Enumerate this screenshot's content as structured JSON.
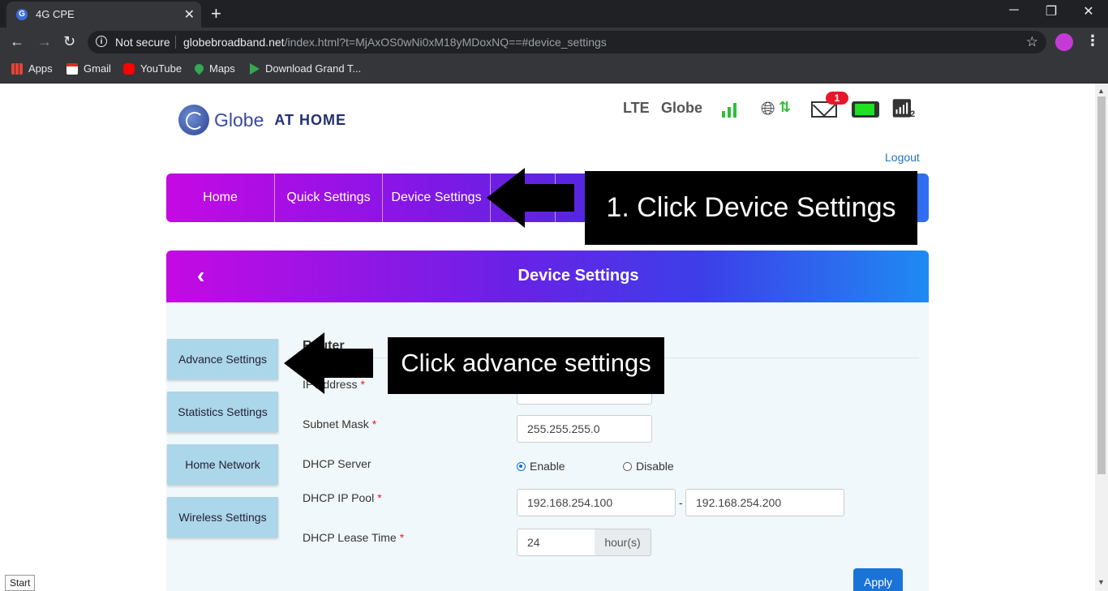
{
  "browser": {
    "tab_title": "4G CPE",
    "tab_favicon": "G",
    "new_tab": "+",
    "window": {
      "minimize": "─",
      "restore": "❐",
      "close": "✕"
    },
    "security_label": "Not secure",
    "url_host": "globebroadband.net",
    "url_path": "/index.html?t=MjAxOS0wNi0xM18yMDoxNQ==#device_settings",
    "bookmarks": [
      "Apps",
      "Gmail",
      "YouTube",
      "Maps",
      "Download Grand T..."
    ]
  },
  "header": {
    "logo_word": "Globe",
    "logo_tag": "AT HOME",
    "network_type": "LTE",
    "carrier": "Globe",
    "mail_count": "1",
    "wifi_clients": "2",
    "logout": "Logout"
  },
  "nav": {
    "items": [
      "Home",
      "Quick Settings",
      "Device Settings"
    ]
  },
  "panel": {
    "title": "Device Settings",
    "side_menu": [
      "Advance Settings",
      "Statistics Settings",
      "Home Network",
      "Wireless Settings"
    ],
    "section_heading": "Router",
    "fields": {
      "ip_address_label": "IP Address",
      "subnet_mask_label": "Subnet Mask",
      "subnet_mask_value": "255.255.255.0",
      "dhcp_server_label": "DHCP Server",
      "dhcp_enable": "Enable",
      "dhcp_disable": "Disable",
      "dhcp_pool_label": "DHCP IP Pool",
      "dhcp_pool_start": "192.168.254.100",
      "dhcp_pool_end": "192.168.254.200",
      "dhcp_pool_sep": "-",
      "dhcp_lease_label": "DHCP Lease Time",
      "dhcp_lease_value": "24",
      "dhcp_lease_unit": "hour(s)",
      "required_mark": "*"
    },
    "apply": "Apply"
  },
  "annotations": {
    "step1": "1. Click Device Settings",
    "step2": "Click advance settings"
  },
  "taskbar": {
    "start": "Start"
  },
  "colors": {
    "nav_gradient_start": "#c509e3",
    "nav_gradient_end": "#2f6ff0",
    "side_button": "#acd6e9",
    "apply_button": "#1a73d6",
    "signal_green": "#2fbf3a",
    "badge_red": "#e8162b"
  }
}
